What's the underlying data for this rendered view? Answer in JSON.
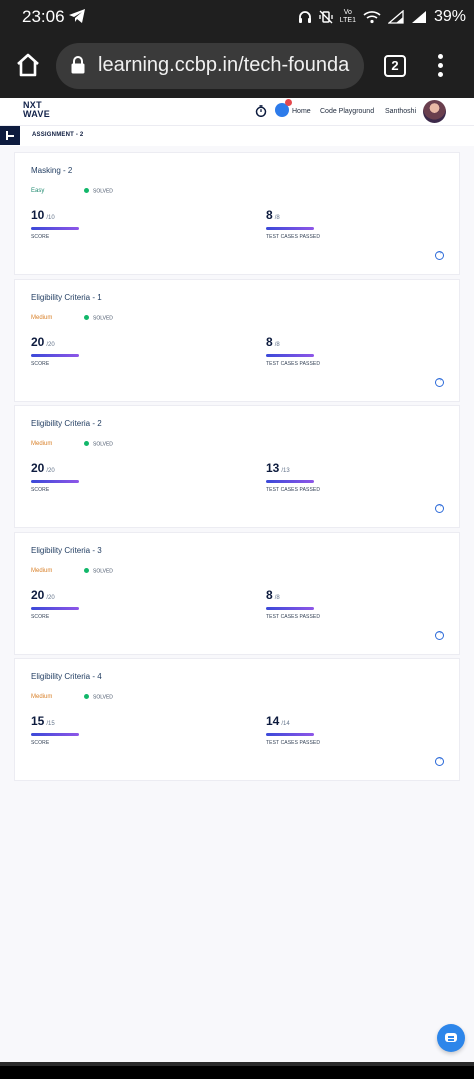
{
  "status_bar": {
    "time": "23:06",
    "volte_line1": "Vo",
    "volte_line2": "LTE1",
    "battery": "39%"
  },
  "browser": {
    "url": "learning.ccbp.in/tech-founda",
    "tab_count": "2"
  },
  "header": {
    "logo_line1": "NXT",
    "logo_line2": "WAVE",
    "nav_home": "Home",
    "nav_playground": "Code Playground",
    "user_name": "Santhoshi",
    "brand_color": "#12224a"
  },
  "subheader": {
    "title": "ASSIGNMENT - 2"
  },
  "cards": [
    {
      "title": "Masking - 2",
      "difficulty": "Easy",
      "status": "SOLVED",
      "score": "10",
      "score_max": "/10",
      "score_label": "SCORE",
      "tests": "8",
      "tests_max": "/8",
      "tests_label": "TEST CASES PASSED"
    },
    {
      "title": "Eligibility Criteria - 1",
      "difficulty": "Medium",
      "status": "SOLVED",
      "score": "20",
      "score_max": "/20",
      "score_label": "SCORE",
      "tests": "8",
      "tests_max": "/8",
      "tests_label": "TEST CASES PASSED"
    },
    {
      "title": "Eligibility Criteria - 2",
      "difficulty": "Medium",
      "status": "SOLVED",
      "score": "20",
      "score_max": "/20",
      "score_label": "SCORE",
      "tests": "13",
      "tests_max": "/13",
      "tests_label": "TEST CASES PASSED"
    },
    {
      "title": "Eligibility Criteria - 3",
      "difficulty": "Medium",
      "status": "SOLVED",
      "score": "20",
      "score_max": "/20",
      "score_label": "SCORE",
      "tests": "8",
      "tests_max": "/8",
      "tests_label": "TEST CASES PASSED"
    },
    {
      "title": "Eligibility Criteria - 4",
      "difficulty": "Medium",
      "status": "SOLVED",
      "score": "15",
      "score_max": "/15",
      "score_label": "SCORE",
      "tests": "14",
      "tests_max": "/14",
      "tests_label": "TEST CASES PASSED"
    }
  ],
  "colors": {
    "easy": "#1f8a70",
    "medium": "#d9822b",
    "solved_dot": "#12b76a",
    "progress_start": "#3b49d8",
    "progress_end": "#8e56e8"
  }
}
